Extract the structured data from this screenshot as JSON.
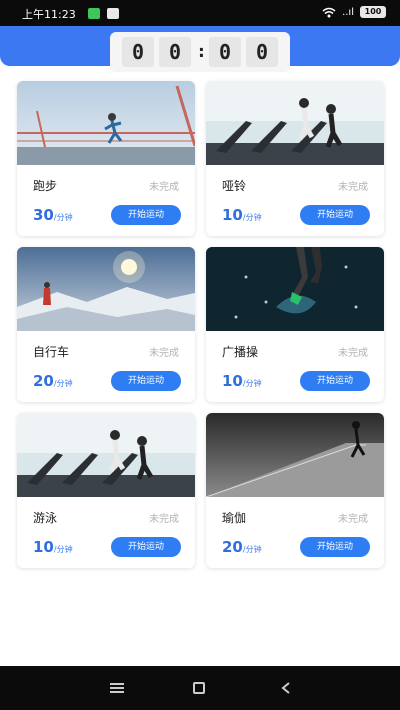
{
  "status_bar": {
    "time": "上午11:23",
    "network": "..ıl",
    "battery": "100"
  },
  "timer": {
    "digits": [
      "0",
      "0",
      "0",
      "0"
    ],
    "separator": ":"
  },
  "cards": [
    {
      "name": "跑步",
      "status": "未完成",
      "duration": "30",
      "unit": "/分钟",
      "button": "开始运动",
      "photo": "running-on-bridge"
    },
    {
      "name": "哑铃",
      "status": "未完成",
      "duration": "10",
      "unit": "/分钟",
      "button": "开始运动",
      "photo": "treadmill-gym"
    },
    {
      "name": "自行车",
      "status": "未完成",
      "duration": "20",
      "unit": "/分钟",
      "button": "开始运动",
      "photo": "mountain-sunrise"
    },
    {
      "name": "广播操",
      "status": "未完成",
      "duration": "10",
      "unit": "/分钟",
      "button": "开始运动",
      "photo": "runner-splash"
    },
    {
      "name": "游泳",
      "status": "未完成",
      "duration": "10",
      "unit": "/分钟",
      "button": "开始运动",
      "photo": "treadmill-gym"
    },
    {
      "name": "瑜伽",
      "status": "未完成",
      "duration": "20",
      "unit": "/分钟",
      "button": "开始运动",
      "photo": "road-runner-bw"
    }
  ],
  "colors": {
    "accent": "#3b78f2",
    "button": "#2f7df2",
    "duration_text": "#2f6fe0",
    "status_text": "#b3b3b3"
  },
  "icons": {
    "nav": [
      "menu-icon",
      "home-icon",
      "back-icon"
    ]
  }
}
